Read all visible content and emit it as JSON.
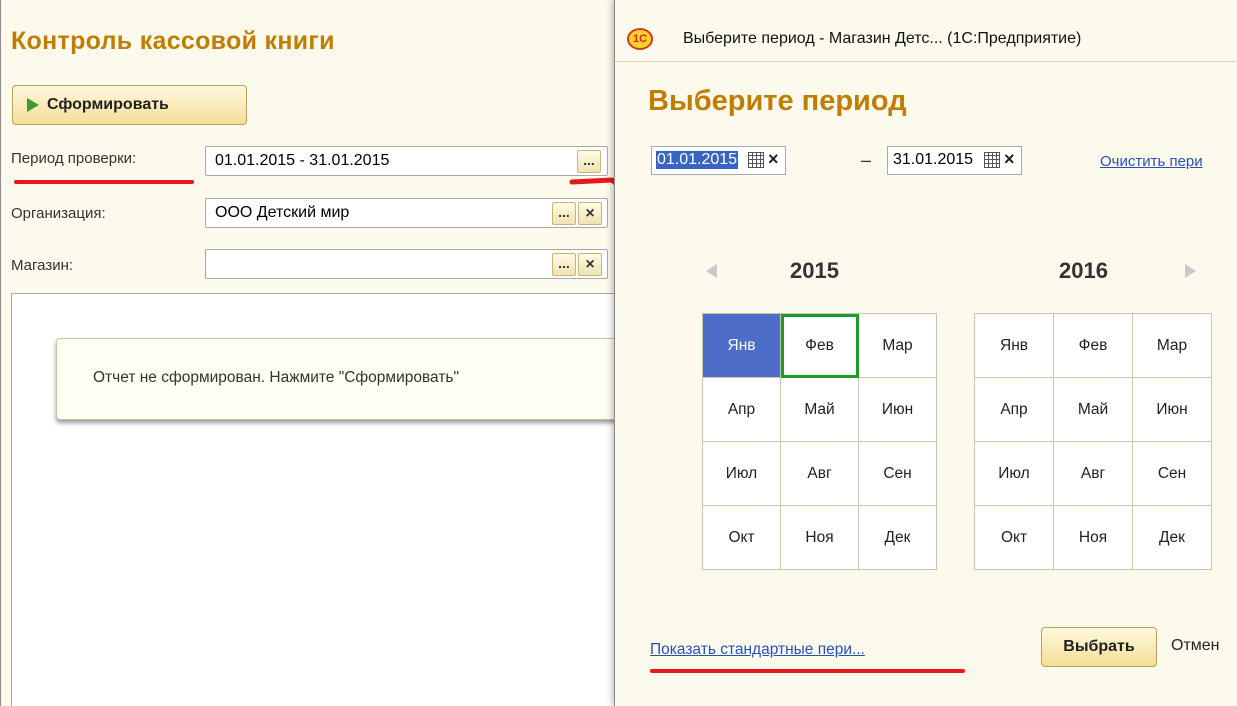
{
  "form": {
    "title": "Контроль кассовой книги",
    "generate_label": "Сформировать",
    "fields": [
      {
        "label": "Период проверки:",
        "value": "01.01.2015 - 31.01.2015"
      },
      {
        "label": "Организация:",
        "value": "ООО Детский мир"
      },
      {
        "label": "Магазин:",
        "value": ""
      }
    ],
    "select_btn": "...",
    "clear_btn": "×",
    "notice": "Отчет не сформирован. Нажмите \"Сформировать\""
  },
  "dialog": {
    "logo": "1С",
    "window_title": "Выберите период - Магазин Детс... (1С:Предприятие)",
    "heading": "Выберите период",
    "date_from": "01.01.2015",
    "date_to": "31.01.2015",
    "dash": "–",
    "clear_link": "Очистить пери",
    "years": [
      "2015",
      "2016"
    ],
    "months": [
      "Янв",
      "Фев",
      "Мар",
      "Апр",
      "Май",
      "Июн",
      "Июл",
      "Авг",
      "Сен",
      "Окт",
      "Ноя",
      "Дек"
    ],
    "selected_month": "Янв 2015",
    "focused_month": "Фев 2015",
    "std_link": "Показать стандартные пери...",
    "choose_label": "Выбрать",
    "cancel_label": "Отмен"
  },
  "colors": {
    "heading": "#c17d00",
    "selected_month": "#4d6dc8",
    "focus_outline": "#1a9b2c",
    "annotation_red": "#e8161f",
    "link": "#2950b8"
  }
}
